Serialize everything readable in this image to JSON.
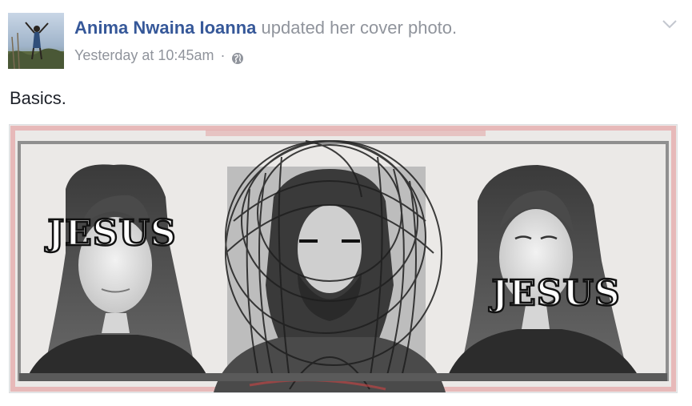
{
  "post": {
    "author_name": "Anima Nwaina Ioanna",
    "action_text": "updated her cover photo.",
    "timestamp": "Yesterday at 10:45am",
    "separator": "·",
    "privacy_icon": "globe-icon",
    "menu_icon": "chevron-down-icon",
    "caption": "Basics.",
    "cover_photo": {
      "overlay_texts": [
        "JESUS",
        "JESUS"
      ]
    }
  },
  "colors": {
    "author_link": "#365899",
    "secondary_text": "#90949c",
    "body_text": "#1d2129"
  }
}
